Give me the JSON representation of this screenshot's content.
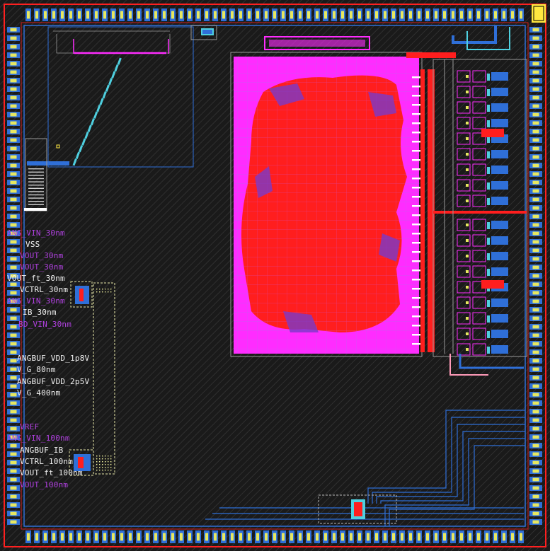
{
  "viewer": {
    "background": "#1a1a1a"
  },
  "colors": {
    "metal1": "#2f6fd8",
    "metal2": "#ff1e1e",
    "poly": "#ff2cff",
    "via": "#4fd0e0",
    "pad_fill": "#e8e860",
    "outline": "#9a9a9a",
    "label_white": "#f2f2f2",
    "label_purple": "#b040e0"
  },
  "net_labels": [
    {
      "text": "ANG_VIN_30nm",
      "tone": "purple"
    },
    {
      "text": "VSS",
      "tone": "white"
    },
    {
      "text": "VOUT_30nm",
      "tone": "purple"
    },
    {
      "text": "VOUT_30nm",
      "tone": "purple"
    },
    {
      "text": "VOUT_ft_30nm",
      "tone": "white"
    },
    {
      "text": "VCTRL_30nm",
      "tone": "white"
    },
    {
      "text": "ANG_VIN_30nm",
      "tone": "purple"
    },
    {
      "text": "IB_30nm",
      "tone": "white"
    },
    {
      "text": "BD_VIN_30nm",
      "tone": "purple"
    },
    {
      "text": "ANGBUF_VDD_1p8V",
      "tone": "white"
    },
    {
      "text": "V_G_80nm",
      "tone": "white"
    },
    {
      "text": "ANGBUF_VDD_2p5V",
      "tone": "white"
    },
    {
      "text": "V_G_400nm",
      "tone": "white"
    },
    {
      "text": "VREF",
      "tone": "purple"
    },
    {
      "text": "ANG_VIN_100nm",
      "tone": "purple"
    },
    {
      "text": "ANGBUF_IB",
      "tone": "white"
    },
    {
      "text": "VCTRL_100nm",
      "tone": "white"
    },
    {
      "text": "VOUT_ft_100nm",
      "tone": "white"
    },
    {
      "text": "VOUT_100nm",
      "tone": "purple"
    }
  ]
}
